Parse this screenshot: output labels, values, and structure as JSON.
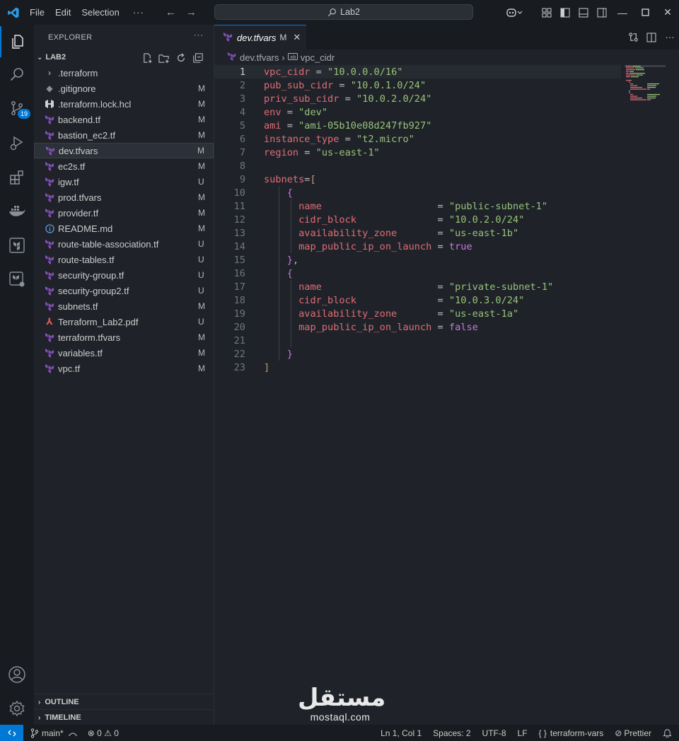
{
  "titlebar": {
    "menu": [
      "File",
      "Edit",
      "Selection"
    ],
    "more": "···",
    "search_text": "Lab2"
  },
  "activitybar": {
    "items": [
      "explorer-icon",
      "search-icon",
      "source-control-icon",
      "run-debug-icon",
      "extensions-icon",
      "docker-icon",
      "terraform-icon",
      "terraform-cloud-icon"
    ],
    "source_control_badge": "19",
    "bottom": [
      "account-icon",
      "settings-gear-icon"
    ]
  },
  "sidebar": {
    "title": "EXPLORER",
    "more": "···",
    "folder": "LAB2",
    "files": [
      {
        "name": ".terraform",
        "status": "",
        "icon": "chevron"
      },
      {
        "name": ".gitignore",
        "status": "M",
        "icon": "git"
      },
      {
        "name": ".terraform.lock.hcl",
        "status": "M",
        "icon": "hcl"
      },
      {
        "name": "backend.tf",
        "status": "M",
        "icon": "terraform"
      },
      {
        "name": "bastion_ec2.tf",
        "status": "M",
        "icon": "terraform"
      },
      {
        "name": "dev.tfvars",
        "status": "M",
        "icon": "terraform"
      },
      {
        "name": "ec2s.tf",
        "status": "M",
        "icon": "terraform"
      },
      {
        "name": "igw.tf",
        "status": "U",
        "icon": "terraform"
      },
      {
        "name": "prod.tfvars",
        "status": "M",
        "icon": "terraform"
      },
      {
        "name": "provider.tf",
        "status": "M",
        "icon": "terraform"
      },
      {
        "name": "README.md",
        "status": "M",
        "icon": "info"
      },
      {
        "name": "route-table-association.tf",
        "status": "U",
        "icon": "terraform"
      },
      {
        "name": "route-tables.tf",
        "status": "U",
        "icon": "terraform"
      },
      {
        "name": "security-group.tf",
        "status": "U",
        "icon": "terraform"
      },
      {
        "name": "security-group2.tf",
        "status": "U",
        "icon": "terraform"
      },
      {
        "name": "subnets.tf",
        "status": "M",
        "icon": "terraform"
      },
      {
        "name": "Terraform_Lab2.pdf",
        "status": "U",
        "icon": "pdf"
      },
      {
        "name": "terraform.tfvars",
        "status": "M",
        "icon": "terraform"
      },
      {
        "name": "variables.tf",
        "status": "M",
        "icon": "terraform"
      },
      {
        "name": "vpc.tf",
        "status": "M",
        "icon": "terraform"
      }
    ],
    "outline": "OUTLINE",
    "timeline": "TIMELINE"
  },
  "editor": {
    "tab": {
      "name": "dev.tfvars",
      "modified": "M"
    },
    "breadcrumb": [
      "dev.tfvars",
      "vpc_cidr"
    ],
    "lines": [
      {
        "n": "1",
        "tokens": [
          [
            "t-key",
            "vpc_cidr"
          ],
          [
            "t-op",
            " = "
          ],
          [
            "t-str",
            "\"10.0.0.0/16\""
          ]
        ]
      },
      {
        "n": "2",
        "tokens": [
          [
            "t-key",
            "pub_sub_cidr"
          ],
          [
            "t-op",
            " = "
          ],
          [
            "t-str",
            "\"10.0.1.0/24\""
          ]
        ]
      },
      {
        "n": "3",
        "tokens": [
          [
            "t-key",
            "priv_sub_cidr"
          ],
          [
            "t-op",
            " = "
          ],
          [
            "t-str",
            "\"10.0.2.0/24\""
          ]
        ]
      },
      {
        "n": "4",
        "tokens": [
          [
            "t-key",
            "env"
          ],
          [
            "t-op",
            " = "
          ],
          [
            "t-str",
            "\"dev\""
          ]
        ]
      },
      {
        "n": "5",
        "tokens": [
          [
            "t-key",
            "ami"
          ],
          [
            "t-op",
            " = "
          ],
          [
            "t-str",
            "\"ami-05b10e08d247fb927\""
          ]
        ]
      },
      {
        "n": "6",
        "tokens": [
          [
            "t-key",
            "instance_type"
          ],
          [
            "t-op",
            " = "
          ],
          [
            "t-str",
            "\"t2.micro\""
          ]
        ]
      },
      {
        "n": "7",
        "tokens": [
          [
            "t-key",
            "region"
          ],
          [
            "t-op",
            " = "
          ],
          [
            "t-str",
            "\"us-east-1\""
          ]
        ]
      },
      {
        "n": "8",
        "tokens": []
      },
      {
        "n": "9",
        "tokens": [
          [
            "t-key",
            "subnets"
          ],
          [
            "t-op",
            "="
          ],
          [
            "t-y",
            "["
          ]
        ]
      },
      {
        "n": "10",
        "tokens": [
          [
            "t-op",
            "    "
          ],
          [
            "t-brk",
            "{"
          ]
        ]
      },
      {
        "n": "11",
        "tokens": [
          [
            "t-op",
            "      "
          ],
          [
            "t-key",
            "name"
          ],
          [
            "t-op",
            "                    = "
          ],
          [
            "t-str",
            "\"public-subnet-1\""
          ]
        ]
      },
      {
        "n": "12",
        "tokens": [
          [
            "t-op",
            "      "
          ],
          [
            "t-key",
            "cidr_block"
          ],
          [
            "t-op",
            "              = "
          ],
          [
            "t-str",
            "\"10.0.2.0/24\""
          ]
        ]
      },
      {
        "n": "13",
        "tokens": [
          [
            "t-op",
            "      "
          ],
          [
            "t-key",
            "availability_zone"
          ],
          [
            "t-op",
            "       = "
          ],
          [
            "t-str",
            "\"us-east-1b\""
          ]
        ]
      },
      {
        "n": "14",
        "tokens": [
          [
            "t-op",
            "      "
          ],
          [
            "t-key",
            "map_public_ip_on_launch"
          ],
          [
            "t-op",
            " = "
          ],
          [
            "t-bool",
            "true"
          ]
        ]
      },
      {
        "n": "15",
        "tokens": [
          [
            "t-op",
            "    "
          ],
          [
            "t-brk",
            "}"
          ],
          [
            "t-op",
            ","
          ]
        ]
      },
      {
        "n": "16",
        "tokens": [
          [
            "t-op",
            "    "
          ],
          [
            "t-brk",
            "{"
          ]
        ]
      },
      {
        "n": "17",
        "tokens": [
          [
            "t-op",
            "      "
          ],
          [
            "t-key",
            "name"
          ],
          [
            "t-op",
            "                    = "
          ],
          [
            "t-str",
            "\"private-subnet-1\""
          ]
        ]
      },
      {
        "n": "18",
        "tokens": [
          [
            "t-op",
            "      "
          ],
          [
            "t-key",
            "cidr_block"
          ],
          [
            "t-op",
            "              = "
          ],
          [
            "t-str",
            "\"10.0.3.0/24\""
          ]
        ]
      },
      {
        "n": "19",
        "tokens": [
          [
            "t-op",
            "      "
          ],
          [
            "t-key",
            "availability_zone"
          ],
          [
            "t-op",
            "       = "
          ],
          [
            "t-str",
            "\"us-east-1a\""
          ]
        ]
      },
      {
        "n": "20",
        "tokens": [
          [
            "t-op",
            "      "
          ],
          [
            "t-key",
            "map_public_ip_on_launch"
          ],
          [
            "t-op",
            " = "
          ],
          [
            "t-bool",
            "false"
          ]
        ]
      },
      {
        "n": "21",
        "tokens": []
      },
      {
        "n": "22",
        "tokens": [
          [
            "t-op",
            "    "
          ],
          [
            "t-brk",
            "}"
          ]
        ]
      },
      {
        "n": "23",
        "tokens": [
          [
            "t-y",
            "]"
          ]
        ]
      }
    ]
  },
  "statusbar": {
    "branch": "main*",
    "errors": "0",
    "warnings": "0",
    "position": "Ln 1, Col 1",
    "spaces": "Spaces: 2",
    "encoding": "UTF-8",
    "eol": "LF",
    "language": "terraform-vars",
    "formatter": "Prettier"
  },
  "watermark": {
    "arabic": "مستقل",
    "latin": "mostaql.com"
  },
  "colors": {
    "accent": "#0078d4",
    "terraform": "#844fba"
  }
}
